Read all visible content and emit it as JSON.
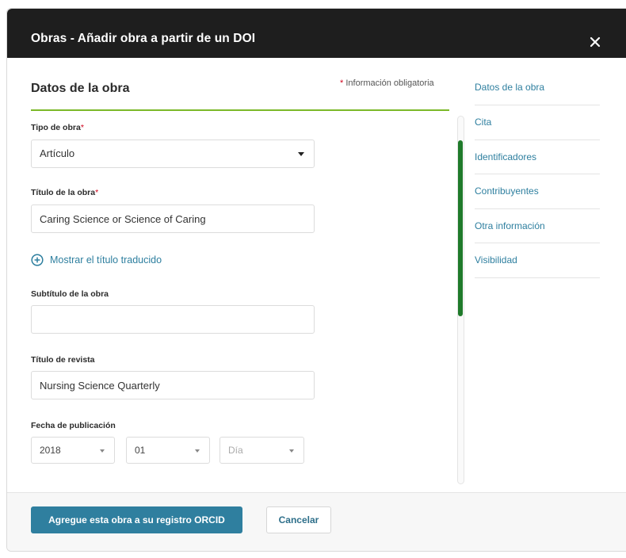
{
  "modal": {
    "title": "Obras - Añadir obra a partir de un DOI"
  },
  "form": {
    "section_title": "Datos de la obra",
    "required_note": "Información obligatoria",
    "work_type": {
      "label": "Tipo de obra",
      "value": "Artículo"
    },
    "work_title": {
      "label": "Título de la obra",
      "value": "Caring Science or Science of Caring"
    },
    "show_translated_title": "Mostrar el título traducido",
    "subtitle": {
      "label": "Subtítulo de la obra",
      "value": ""
    },
    "journal_title": {
      "label": "Título de revista",
      "value": "Nursing Science Quarterly"
    },
    "publication_date": {
      "label": "Fecha de publicación",
      "year": "2018",
      "month": "01",
      "day_placeholder": "Día"
    }
  },
  "side_nav": {
    "items": [
      {
        "label": "Datos de la obra"
      },
      {
        "label": "Cita"
      },
      {
        "label": "Identificadores"
      },
      {
        "label": "Contribuyentes"
      },
      {
        "label": "Otra información"
      },
      {
        "label": "Visibilidad"
      }
    ]
  },
  "footer": {
    "primary_label": "Agregue esta obra a su registro ORCID",
    "cancel_label": "Cancelar"
  },
  "colors": {
    "header_bg": "#1e1e1e",
    "accent_green": "#7cb928",
    "link_blue": "#2e7f9f",
    "primary_button": "#2f7f9f",
    "required_star": "#d0021b"
  }
}
